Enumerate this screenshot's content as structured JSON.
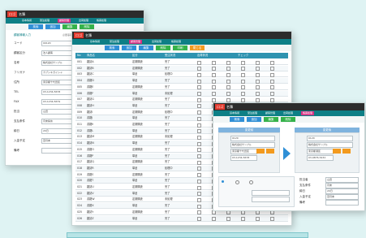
{
  "app": {
    "logo": "ロゴ",
    "title": "名簿"
  },
  "menu": [
    "基本情報",
    "受注処理",
    "顧客管理",
    "出荷処理",
    "帳票処理"
  ],
  "toolbar": {
    "search": "検索",
    "add": "追加",
    "edit": "編集",
    "delete": "削除",
    "print": "印刷",
    "close": "閉じる"
  },
  "win1": {
    "heading": "顧客情報入力",
    "note": "必要事項を入力してください",
    "form_labels": [
      "コード",
      "顧客区分",
      "名称",
      "フリガナ",
      "住所",
      "TEL",
      "FAX",
      "担当",
      "支払条件",
      "締日",
      "入金予定",
      "備考"
    ],
    "form_values": [
      "00120",
      "法人顧客",
      "株式会社サンプル",
      "カブシキガイシャ",
      "東京都千代田区",
      "03-1234-5678",
      "03-1234-5679",
      "山田",
      "月末締め",
      "20日",
      "翌月末",
      ""
    ]
  },
  "win2": {
    "columns": [
      "No",
      "商品名",
      "区分",
      "受注状況",
      "出荷状況",
      "チェック"
    ],
    "rows": [
      [
        "001",
        "雑誌A",
        "定期購読",
        "完了"
      ],
      [
        "002",
        "雑誌B",
        "定期購読",
        "完了"
      ],
      [
        "003",
        "雑誌C",
        "単品",
        "処理中"
      ],
      [
        "004",
        "書籍D",
        "単品",
        "完了"
      ],
      [
        "005",
        "書籍E",
        "定期購読",
        "完了"
      ],
      [
        "006",
        "書籍F",
        "単品",
        "未処理"
      ],
      [
        "007",
        "雑誌G",
        "定期購読",
        "完了"
      ],
      [
        "008",
        "雑誌H",
        "単品",
        "完了"
      ],
      [
        "009",
        "雑誌I",
        "定期購読",
        "処理中"
      ],
      [
        "010",
        "書籍J",
        "単品",
        "完了"
      ],
      [
        "011",
        "書籍K",
        "定期購読",
        "完了"
      ],
      [
        "012",
        "書籍L",
        "単品",
        "完了"
      ],
      [
        "013",
        "雑誌M",
        "定期購読",
        "未処理"
      ],
      [
        "014",
        "雑誌N",
        "単品",
        "完了"
      ],
      [
        "015",
        "書籍O",
        "定期購読",
        "完了"
      ],
      [
        "016",
        "書籍P",
        "単品",
        "完了"
      ],
      [
        "017",
        "雑誌Q",
        "定期購読",
        "完了"
      ],
      [
        "018",
        "雑誌R",
        "単品",
        "処理中"
      ],
      [
        "019",
        "書籍S",
        "定期購読",
        "完了"
      ],
      [
        "020",
        "書籍T",
        "単品",
        "完了"
      ],
      [
        "021",
        "雑誌U",
        "定期購読",
        "完了"
      ],
      [
        "022",
        "雑誌V",
        "単品",
        "完了"
      ],
      [
        "023",
        "書籍W",
        "定期購読",
        "未処理"
      ],
      [
        "024",
        "書籍X",
        "単品",
        "完了"
      ],
      [
        "025",
        "雑誌Y",
        "定期購読",
        "完了"
      ],
      [
        "026",
        "雑誌Z",
        "単品",
        "完了"
      ]
    ]
  },
  "win3": {
    "left_panel": "変更前",
    "right_panel": "変更後",
    "left_fields": [
      "0120",
      "株式会社サンプル",
      "東京都千代田区",
      "03-1234-5678"
    ],
    "right_fields": [
      "0120",
      "株式会社サンプル",
      "東京都港区",
      "03-9876-5432"
    ],
    "side_labels": [
      "担当者",
      "支払条件",
      "締日",
      "入金予定",
      "備考"
    ],
    "side_values": [
      "山田",
      "月末",
      "20日",
      "翌月末",
      ""
    ]
  },
  "colors": {
    "teal": "#0e7f86",
    "blue": "#2f8fd6",
    "green": "#35b24a",
    "orange": "#f39a1e",
    "magenta": "#d63384"
  }
}
